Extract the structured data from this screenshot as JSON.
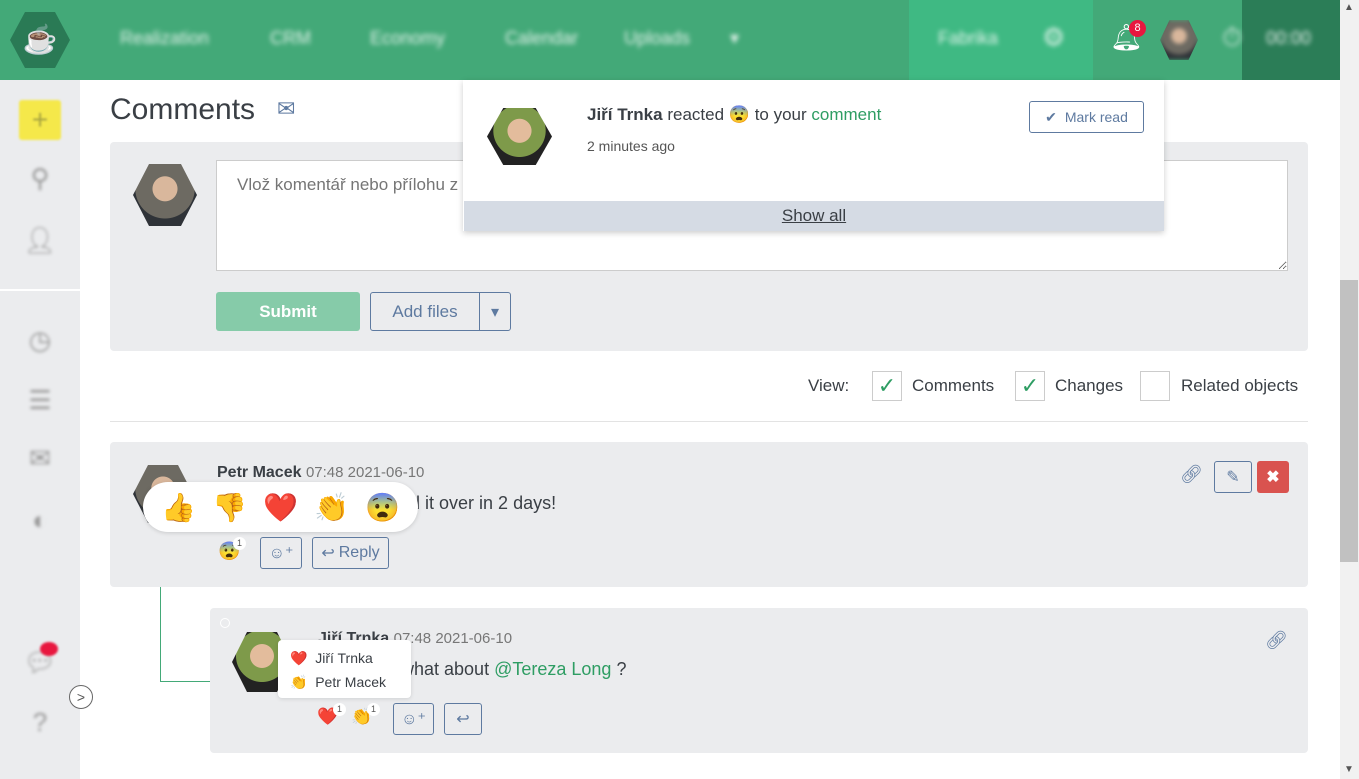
{
  "nav": {
    "items": [
      "Realization",
      "CRM",
      "Economy",
      "Calendar",
      "Uploads"
    ],
    "company": "Fabrika",
    "notification_count": "8",
    "timer": "00:00"
  },
  "colors": {
    "brand": "#43a978",
    "danger": "#d9534f",
    "link": "#2e9d63"
  },
  "sidebar": {
    "icons": [
      "plus-icon",
      "search-icon",
      "user-icon",
      "clock-icon",
      "list-icon",
      "chat-icon",
      "toggle-icon",
      "messages-icon",
      "help-icon"
    ]
  },
  "page": {
    "title": "Comments"
  },
  "editor": {
    "placeholder": "Vlož komentář nebo přílohu z",
    "submit": "Submit",
    "add_files": "Add files"
  },
  "view": {
    "label": "View:",
    "options": [
      {
        "label": "Comments",
        "checked": true
      },
      {
        "label": "Changes",
        "checked": true
      },
      {
        "label": "Related objects",
        "checked": false
      }
    ]
  },
  "notification": {
    "user": "Jiří Trnka",
    "reacted": "reacted",
    "emoji": "😨",
    "to_your": "to your",
    "link": "comment",
    "time": "2 minutes ago",
    "mark_read": "Mark read",
    "show_all": "Show all"
  },
  "comments": [
    {
      "author": "Petr Macek",
      "time": "07:48 2021-06-10",
      "text": "nd it over in 2 days!",
      "reactions": [
        {
          "emoji": "😨",
          "count": "1"
        }
      ],
      "reply": "Reply"
    },
    {
      "author": "Jiří Trnka",
      "time": "07:48 2021-06-10",
      "text_before": "f it, what about",
      "mention": "@Tereza Long",
      "text_after": "?",
      "reactions": [
        {
          "emoji": "❤️",
          "count": "1"
        },
        {
          "emoji": "👏",
          "count": "1"
        }
      ]
    }
  ],
  "reaction_picker": [
    "👍",
    "👎",
    "❤️",
    "👏",
    "😨"
  ],
  "reaction_tooltip": [
    {
      "emoji": "❤️",
      "name": "Jiří Trnka"
    },
    {
      "emoji": "👏",
      "name": "Petr Macek"
    }
  ]
}
